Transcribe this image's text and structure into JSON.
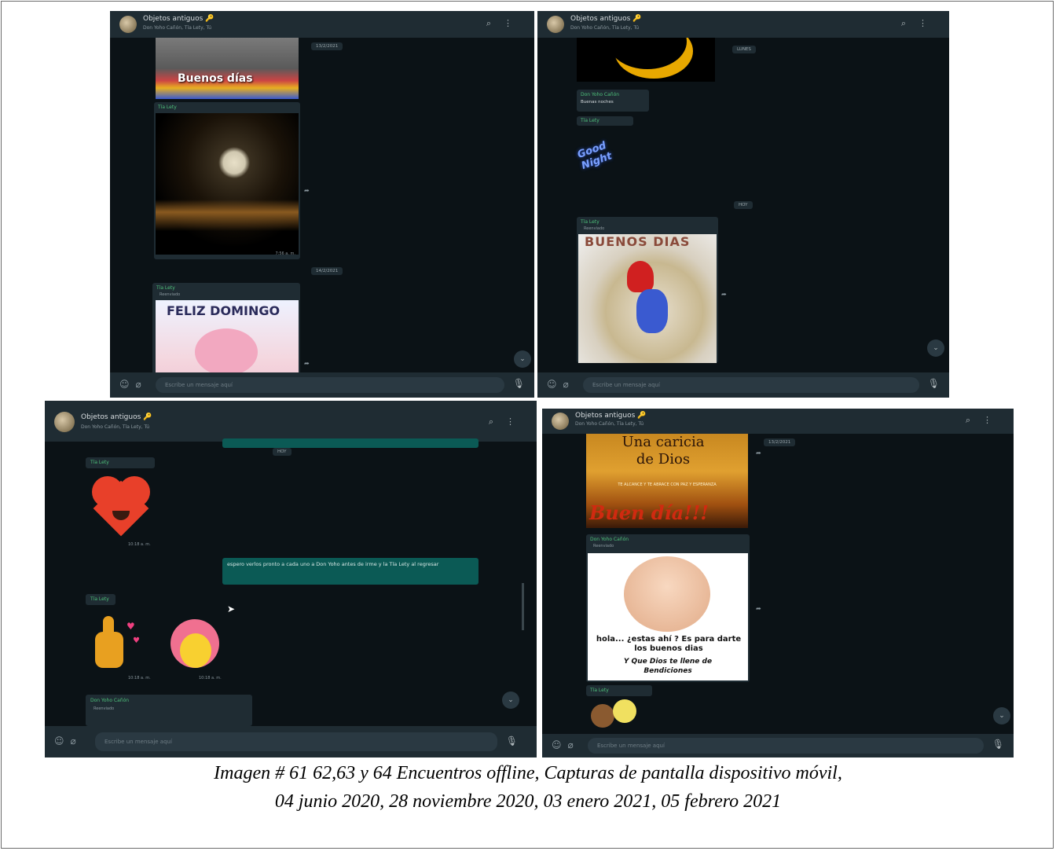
{
  "screens": [
    {
      "header": {
        "title": "Objetos antiguos 🔑",
        "subtitle": "Don Yoho Cañón, Tía Lety, Tú"
      },
      "footer": {
        "placeholder": "Escribe un mensaje aquí"
      },
      "dates": [
        "13/2/2021",
        "14/2/2021"
      ],
      "image_texts": [
        "Buenos días",
        "FELIZ DOMINGO"
      ],
      "senders": [
        "Tía Lety",
        "Tía Lety"
      ],
      "forwarded": "Reenviado"
    },
    {
      "header": {
        "title": "Objetos antiguos 🔑",
        "subtitle": "Don Yoho Cañón, Tía Lety, Tú"
      },
      "footer": {
        "placeholder": "Escribe un mensaje aquí"
      },
      "dates": [
        "LUNES",
        "HOY"
      ],
      "messages": [
        {
          "sender": "Don Yoho Cañón",
          "text": "Buenas noches"
        }
      ],
      "senders": [
        "Tía Lety",
        "Tía Lety"
      ],
      "sticker_text": "Good Night",
      "image_texts": [
        "BUENOS DIAS"
      ],
      "forwarded": "Reenviado"
    },
    {
      "header": {
        "title": "Objetos antiguos 🔑",
        "subtitle": "Don Yoho Cañón, Tía Lety, Tú"
      },
      "footer": {
        "placeholder": "Escribe un mensaje aquí"
      },
      "dates": [
        "HOY"
      ],
      "senders": [
        "Tía Lety",
        "Tía Lety",
        "Don Yoho Cañón"
      ],
      "outgoing": "espero verlos pronto a cada uno a Don Yoho antes de irme y la Tía Lety al regresar",
      "forwarded": "Reenviado"
    },
    {
      "header": {
        "title": "Objetos antiguos 🔑",
        "subtitle": "Don Yoho Cañón, Tía Lety, Tú"
      },
      "footer": {
        "placeholder": "Escribe un mensaje aquí"
      },
      "dates": [
        "13/2/2021"
      ],
      "image_texts": [
        "Una caricia de Dios",
        "TE ALCANCE Y TE ABRACE CON PAZ Y ESPERANZA",
        "Buen día!!!",
        "hola... ¿estas ahí ? Es para darte los buenos dias",
        "Y Que Dios te llene de Bendiciones"
      ],
      "senders": [
        "Don Yoho Cañón",
        "Tía Lety"
      ],
      "forwarded": "Reenviado"
    }
  ],
  "caption": {
    "line1": "Imagen # 61 62,63 y 64 Encuentros offline, Capturas de pantalla dispositivo móvil,",
    "line2": "04 junio 2020, 28 noviembre 2020, 03 enero 2021, 05 febrero 2021"
  }
}
